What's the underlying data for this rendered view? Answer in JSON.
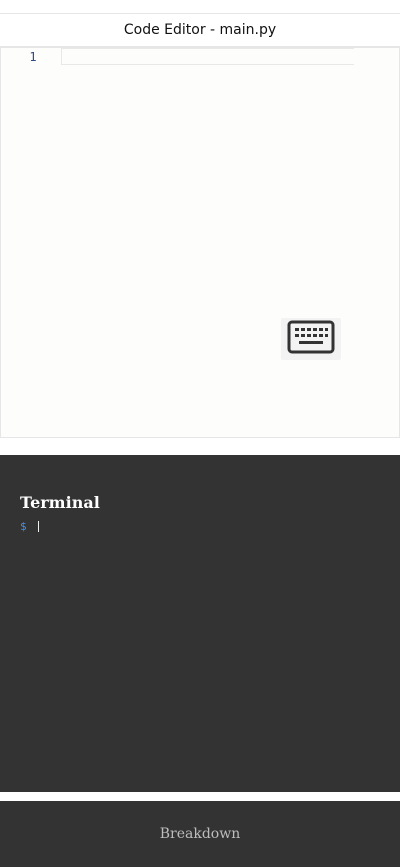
{
  "header": {
    "title": "Code Editor - main.py"
  },
  "editor": {
    "line_numbers": [
      "1"
    ],
    "lines": [
      ""
    ]
  },
  "keyboard": {
    "icon": "keyboard-icon"
  },
  "terminal": {
    "heading": "Terminal",
    "prompt": "$"
  },
  "footer": {
    "label": "Breakdown"
  }
}
